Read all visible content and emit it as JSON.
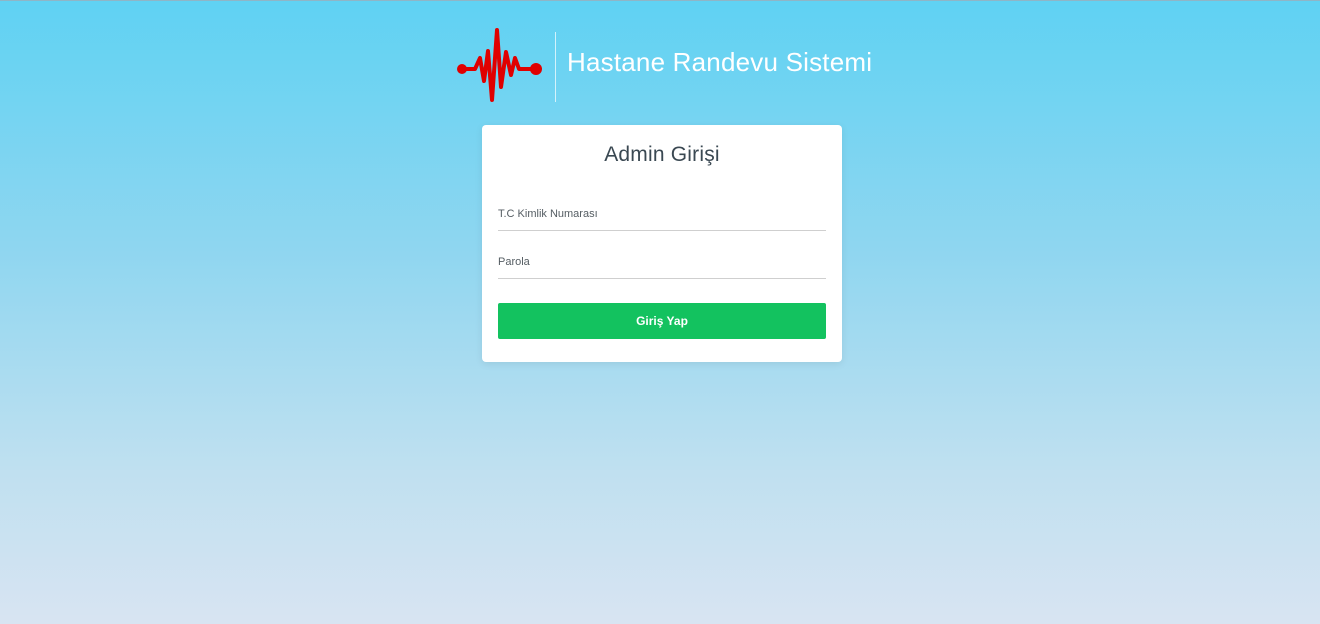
{
  "brand": {
    "title": "Hastane Randevu Sistemi",
    "logo_icon": "heartbeat-pulse-icon",
    "logo_color": "#e00000"
  },
  "login": {
    "heading": "Admin Girişi",
    "tc_field": {
      "placeholder": "T.C Kimlik Numarası",
      "value": ""
    },
    "password_field": {
      "placeholder": "Parola",
      "value": ""
    },
    "submit_label": "Giriş Yap"
  },
  "colors": {
    "accent": "#13c25f",
    "heading_text": "#3a4852",
    "background_top": "#5fd2f3",
    "background_bottom": "#d8e4f2"
  }
}
